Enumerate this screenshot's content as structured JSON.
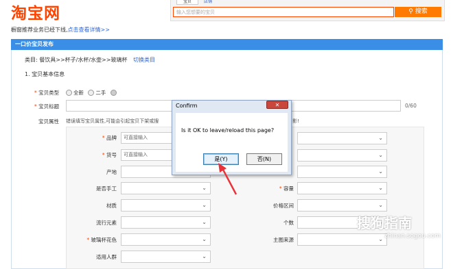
{
  "header": {
    "logo": "淘宝网",
    "tabs": [
      "宝贝",
      "店铺"
    ],
    "search_placeholder": "输入您想要的宝贝",
    "search_button": "搜索"
  },
  "notice": {
    "text": "橱窗推荐业务已经下线,",
    "link": "点击查看详情>>"
  },
  "panel": {
    "title": "一口价宝贝发布",
    "category_prefix": "类目:",
    "category_path": "餐饮具>>杯子/水杯/水壶>>玻璃杯",
    "category_switch": "切换类目",
    "section_title": "1. 宝贝基本信息"
  },
  "form": {
    "type_label": "宝贝类型",
    "type_new": "全新",
    "type_used": "二手",
    "title_label": "宝贝标题",
    "title_counter": "0/60",
    "attr_label": "宝贝属性",
    "attr_hint": "错误填写宝贝属性,可能会引起宝贝下架或搜",
    "attr_hint_end": "影!",
    "attrs_left": [
      {
        "label": "品牌",
        "required": true,
        "placeholder": "可直接输入"
      },
      {
        "label": "货号",
        "required": true,
        "placeholder": "可直接输入"
      },
      {
        "label": "产地",
        "required": false
      },
      {
        "label": "是否手工",
        "required": false
      },
      {
        "label": "材质",
        "required": false
      },
      {
        "label": "流行元素",
        "required": false
      },
      {
        "label": "玻璃杯花色",
        "required": true
      },
      {
        "label": "适用人群",
        "required": false
      }
    ],
    "attrs_right": [
      {
        "label": "容量",
        "required": true
      },
      {
        "label": "价格区间",
        "required": false
      },
      {
        "label": "个数",
        "required": false
      },
      {
        "label": "主图来源",
        "required": false
      }
    ]
  },
  "dialog": {
    "title": "Confirm",
    "close": "✕",
    "message": "Is it OK to leave/reload this page?",
    "yes": "是(Y)",
    "no": "否(N)"
  },
  "watermark": {
    "main": "搜狗指南",
    "sub": "zhinan.sogou.com"
  },
  "colors": {
    "brand": "#ff4400",
    "panel_header": "#3a8ee6",
    "arrow": "#e8333a"
  }
}
